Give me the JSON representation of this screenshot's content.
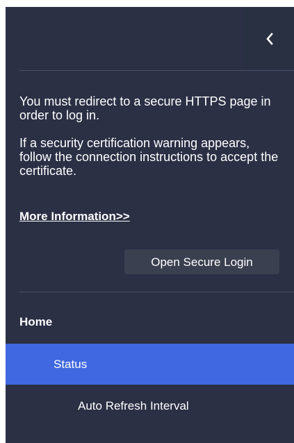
{
  "panel": {
    "collapse_icon": "chevron-left-icon",
    "notice": {
      "paragraph_1": "You must redirect to a secure HTTPS page in order to log in.",
      "paragraph_2": "If a security certification warning appears, follow the connection instructions to accept the certificate."
    },
    "more_info_link": "More Information>>",
    "secure_login_button": "Open Secure Login"
  },
  "nav": {
    "home": "Home",
    "items": [
      {
        "label": "Status",
        "active": true
      },
      {
        "label": "Auto Refresh Interval",
        "active": false
      }
    ]
  },
  "colors": {
    "panel_bg": "#2b3045",
    "active_item": "#4068e0",
    "button_bg": "#3b4050"
  }
}
